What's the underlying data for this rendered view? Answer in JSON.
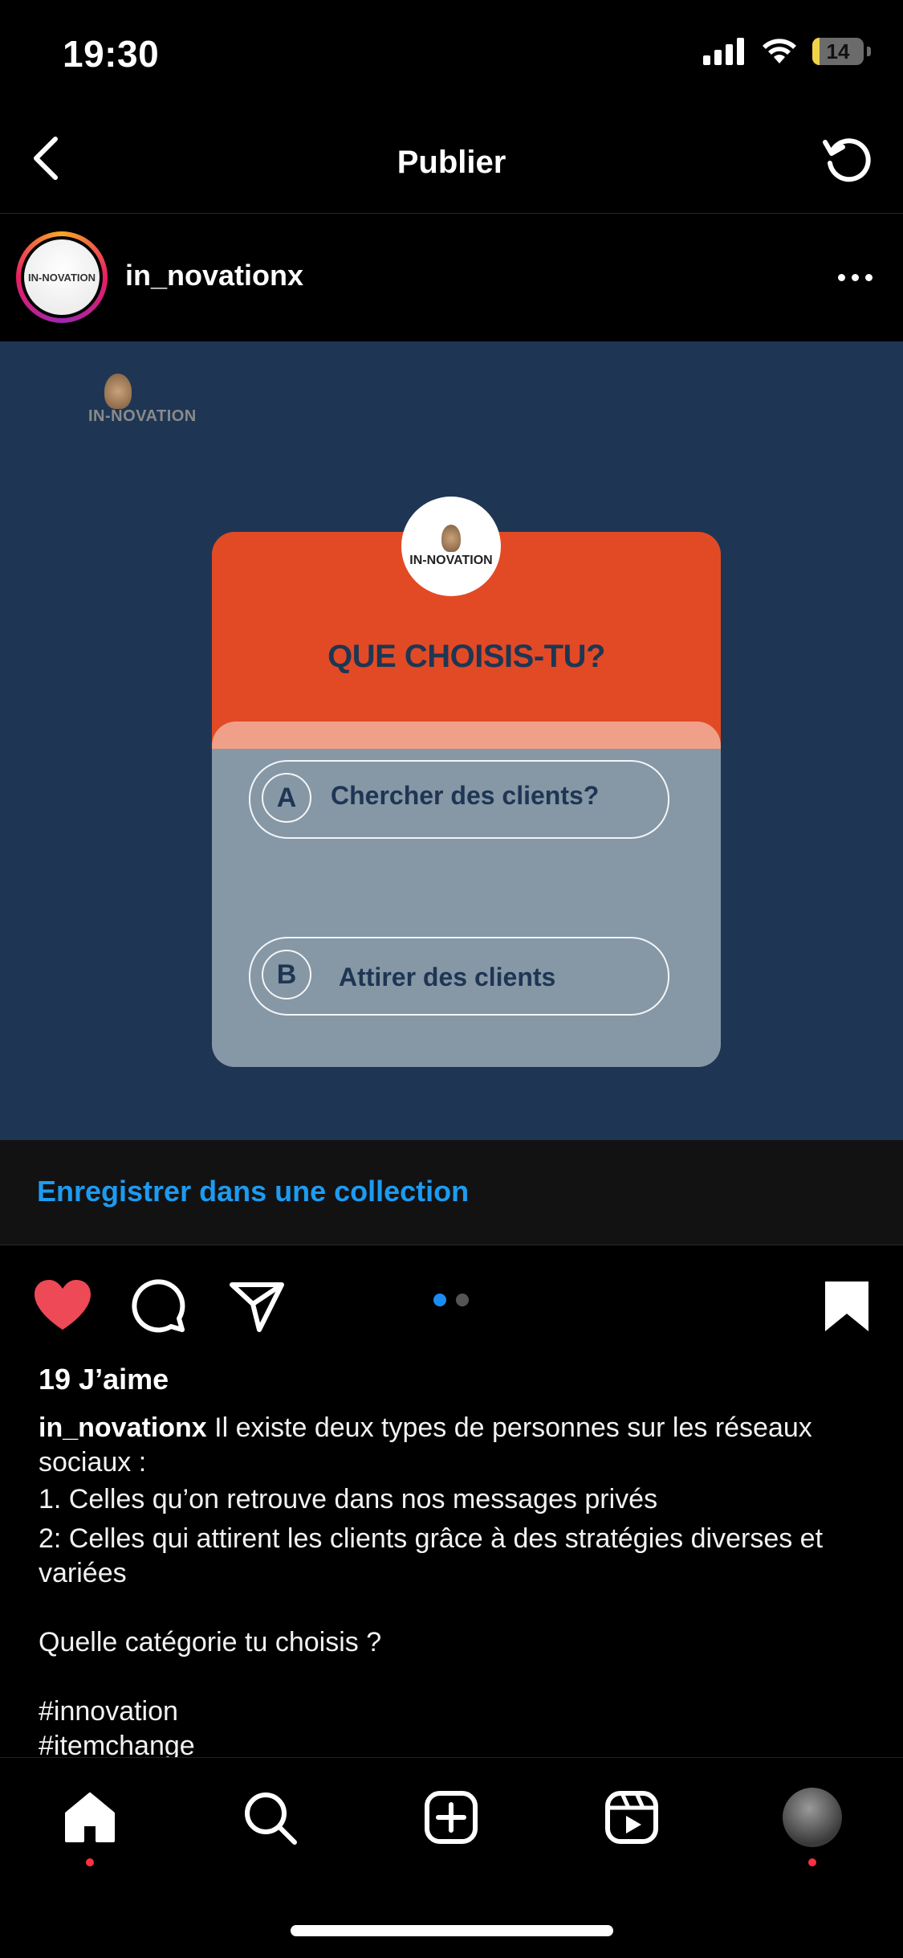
{
  "status_bar": {
    "time": "19:30",
    "battery": "14"
  },
  "nav": {
    "title": "Publier"
  },
  "post": {
    "username": "in_novationx",
    "avatar_text": "IN-NOVATION",
    "watermark_text": "IN-NOVATION",
    "image": {
      "logo_text": "IN-NOVATION",
      "question": "QUE CHOISIS-TU?",
      "options": [
        {
          "letter": "A",
          "label": "Chercher des clients?"
        },
        {
          "letter": "B",
          "label": "Attirer des clients"
        }
      ]
    },
    "collection_link": "Enregistrer dans une collection",
    "carousel": {
      "count": 2,
      "active": 1
    },
    "likes": "19 J’aime",
    "caption": {
      "user": "in_novationx",
      "line1": " Il existe deux types de personnes sur les réseaux sociaux :",
      "line2": "1. Celles qu’on retrouve dans nos messages privés",
      "line3": "2: Celles qui attirent les clients grâce à des stratégies diverses et variées",
      "line4": "Quelle catégorie tu choisis ?",
      "line5": "#innovation",
      "line6": "#itemchange"
    },
    "liked": true,
    "saved": true
  },
  "colors": {
    "accent_blue": "#1d9bf0",
    "like_red": "#ed4956",
    "card_orange": "#e24a25",
    "image_bg": "#1e3653"
  },
  "tabbar": {
    "items": [
      "home-icon",
      "search-icon",
      "create-icon",
      "reels-icon",
      "profile-avatar"
    ]
  }
}
